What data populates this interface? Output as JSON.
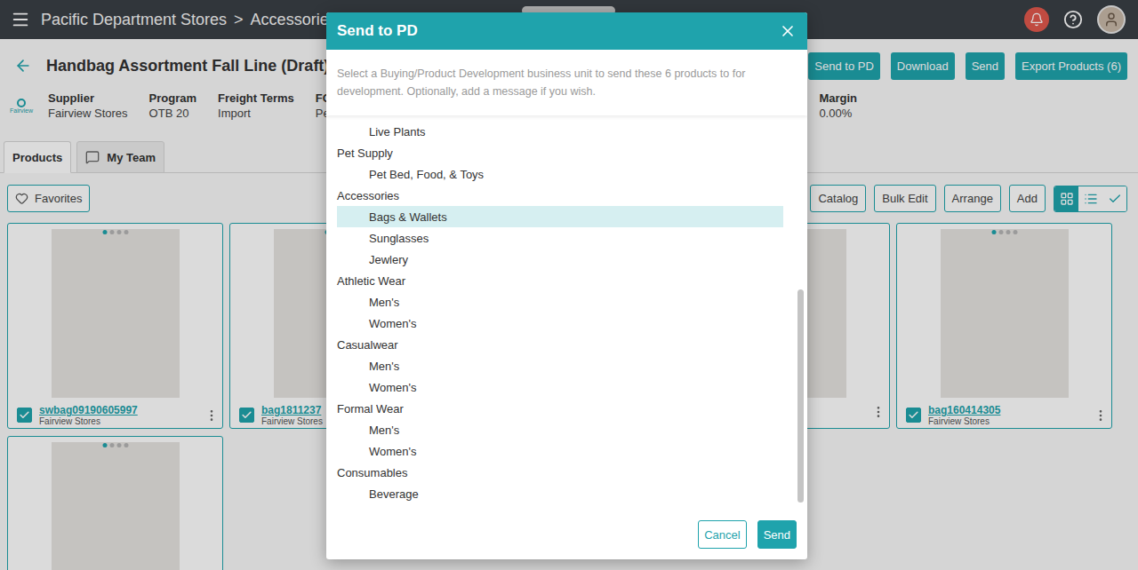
{
  "topbar": {
    "breadcrumb": [
      {
        "label": "Pacific Department Stores"
      },
      {
        "label": "Accessorie"
      }
    ],
    "separator": ">"
  },
  "page": {
    "title": "Handbag Assortment Fall Line (Draft)",
    "actions": [
      "Send to PD",
      "Download",
      "Send",
      "Export Products (6)"
    ],
    "logo": "Fairview",
    "info": [
      {
        "label": "Supplier",
        "value": "Fairview Stores"
      },
      {
        "label": "Program",
        "value": "OTB 20"
      },
      {
        "label": "Freight Terms",
        "value": "Import"
      },
      {
        "label": "FOB",
        "value": "Per"
      }
    ],
    "info_right": [
      {
        "label": "Margin",
        "value": "0.00%"
      }
    ]
  },
  "tabs": [
    {
      "label": "Products",
      "selected": true,
      "kind": "plain"
    },
    {
      "label": "My Team",
      "selected": false,
      "kind": "chat"
    }
  ],
  "toolbar": {
    "favorites": "Favorites",
    "actions": [
      "Catalog",
      "Bulk Edit",
      "Arrange",
      "Add"
    ],
    "views": [
      {
        "kind": "grid",
        "selected": true
      },
      {
        "kind": "list",
        "selected": false
      },
      {
        "kind": "check",
        "selected": false
      }
    ]
  },
  "cards": [
    {
      "name": "swbag09190605997",
      "supplier": "Fairview Stores",
      "checked": true,
      "image_count": 4,
      "image_index": 0
    },
    {
      "name": "bag1811237",
      "supplier": "Fairview Stores",
      "checked": true,
      "image_count": 4,
      "image_index": 0
    },
    {
      "name": "",
      "supplier": "",
      "checked": true,
      "image_count": 4,
      "image_index": 0
    },
    {
      "name": "",
      "supplier": "",
      "checked": true,
      "image_count": 4,
      "image_index": 0
    },
    {
      "name": "bag160414305",
      "supplier": "Fairview Stores",
      "checked": true,
      "image_count": 4,
      "image_index": 0
    },
    {
      "name": "",
      "supplier": "",
      "checked": true,
      "image_count": 4,
      "image_index": 0
    }
  ],
  "dialog": {
    "title": "Send to PD",
    "description": "Select a Buying/Product Development business unit to send these 6 products to for development. Optionally, add a message if you wish.",
    "units": [
      {
        "label": "Live Plants",
        "kind": "item",
        "selected": false
      },
      {
        "label": "Pet Supply",
        "kind": "group",
        "selected": false
      },
      {
        "label": "Pet Bed, Food, & Toys",
        "kind": "item",
        "selected": false
      },
      {
        "label": "Accessories",
        "kind": "group",
        "selected": false
      },
      {
        "label": "Bags & Wallets",
        "kind": "item",
        "selected": true
      },
      {
        "label": "Sunglasses",
        "kind": "item",
        "selected": false
      },
      {
        "label": "Jewlery",
        "kind": "item",
        "selected": false
      },
      {
        "label": "Athletic Wear",
        "kind": "group",
        "selected": false
      },
      {
        "label": "Men's",
        "kind": "item",
        "selected": false
      },
      {
        "label": "Women's",
        "kind": "item",
        "selected": false
      },
      {
        "label": "Casualwear",
        "kind": "group",
        "selected": false
      },
      {
        "label": "Men's",
        "kind": "item",
        "selected": false
      },
      {
        "label": "Women's",
        "kind": "item",
        "selected": false
      },
      {
        "label": "Formal Wear",
        "kind": "group",
        "selected": false
      },
      {
        "label": "Men's",
        "kind": "item",
        "selected": false
      },
      {
        "label": "Women's",
        "kind": "item",
        "selected": false
      },
      {
        "label": "Consumables",
        "kind": "group",
        "selected": false
      },
      {
        "label": "Beverage",
        "kind": "item",
        "selected": false
      }
    ],
    "buttons": [
      {
        "label": "Cancel",
        "kind": "secondary"
      },
      {
        "label": "Send",
        "kind": "primary"
      }
    ]
  }
}
